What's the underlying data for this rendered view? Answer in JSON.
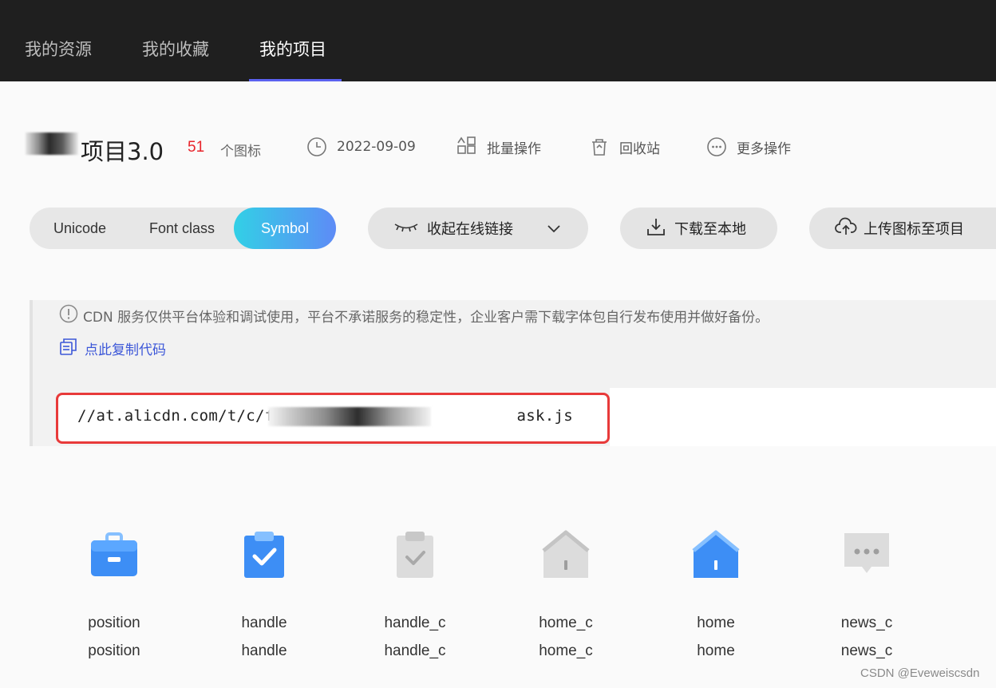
{
  "nav": {
    "tabs": [
      {
        "label": "我的资源"
      },
      {
        "label": "我的收藏"
      },
      {
        "label": "我的项目"
      }
    ],
    "active_tab": "我的项目"
  },
  "project": {
    "title": "项目3.0",
    "icon_count": "51",
    "icon_count_label": "个图标",
    "date": "2022-09-09",
    "batch_label": "批量操作",
    "recycle_label": "回收站",
    "more_label": "更多操作"
  },
  "format_tabs": {
    "items": [
      "Unicode",
      "Font class",
      "Symbol"
    ],
    "active": "Symbol"
  },
  "actions": {
    "collapse_label": "收起在线链接",
    "download_label": "下载至本地",
    "upload_label": "上传图标至项目"
  },
  "cdn": {
    "notice": "CDN 服务仅供平台体验和调试使用，平台不承诺服务的稳定性，企业客户需下载字体包自行发布使用并做好备份。",
    "copy_label": "点此复制代码",
    "url_prefix": "//at.alicdn.com/t/c/f",
    "url_suffix": "ask.js"
  },
  "icons": [
    {
      "name": "position",
      "code": "position",
      "icon": "briefcase-icon",
      "color": "#3d8ef5"
    },
    {
      "name": "handle",
      "code": "handle",
      "icon": "clipboard-check-icon",
      "color": "#3d8ef5"
    },
    {
      "name": "handle_c",
      "code": "handle_c",
      "icon": "clipboard-check-icon",
      "color": "#d9d9d9"
    },
    {
      "name": "home_c",
      "code": "home_c",
      "icon": "home-icon",
      "color": "#d9d9d9"
    },
    {
      "name": "home",
      "code": "home",
      "icon": "home-icon",
      "color": "#3d8ef5"
    },
    {
      "name": "news_c",
      "code": "news_c",
      "icon": "message-dots-icon",
      "color": "#d9d9d9"
    }
  ],
  "watermark": "CSDN @Eveweiscsdn",
  "colors": {
    "accent": "#5b62f0",
    "count_red": "#e8242b",
    "link_blue": "#3c57d8",
    "highlight_red": "#e83a3a",
    "icon_blue": "#3d8ef5",
    "icon_gray": "#d9d9d9"
  }
}
